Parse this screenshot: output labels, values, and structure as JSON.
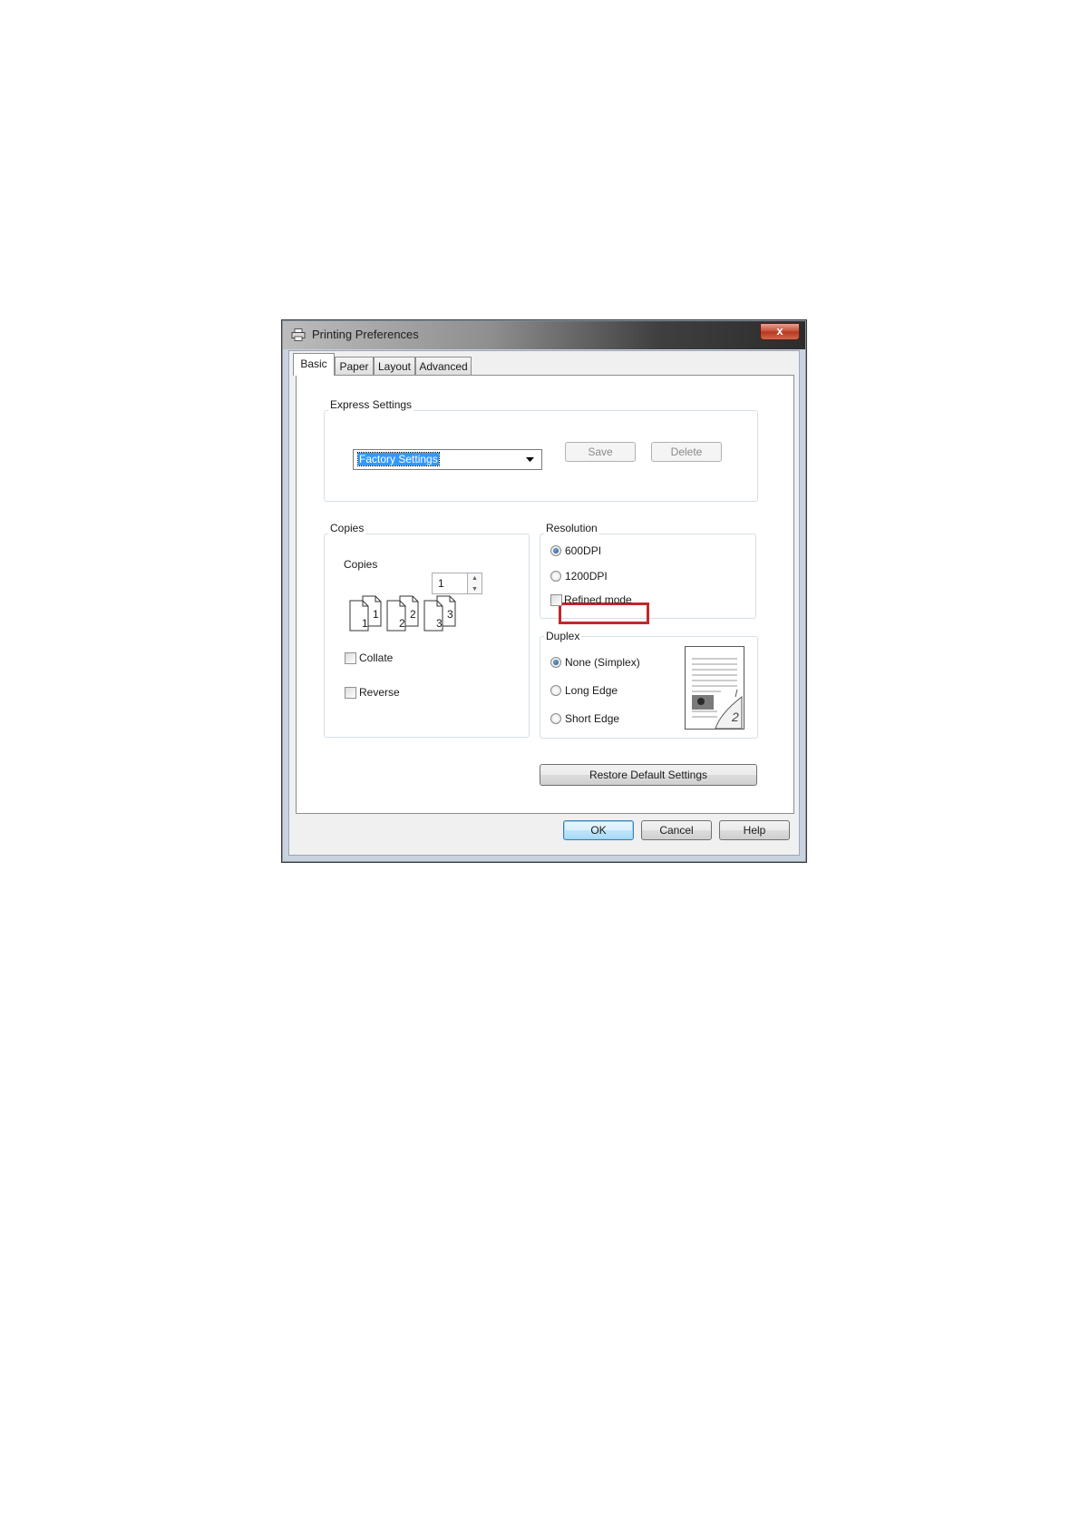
{
  "window": {
    "title": "Printing Preferences",
    "close_label": "x"
  },
  "tabs": [
    {
      "label": "Basic",
      "active": true
    },
    {
      "label": "Paper",
      "active": false
    },
    {
      "label": "Layout",
      "active": false
    },
    {
      "label": "Advanced",
      "active": false
    }
  ],
  "express_settings": {
    "legend": "Express Settings",
    "selected": "Factory Settings",
    "save_label": "Save",
    "delete_label": "Delete"
  },
  "copies_group": {
    "legend": "Copies",
    "copies_label": "Copies",
    "copies_value": "1",
    "page_icons": [
      {
        "front": "1",
        "back": "1"
      },
      {
        "front": "2",
        "back": "2"
      },
      {
        "front": "3",
        "back": "3"
      }
    ],
    "collate_label": "Collate",
    "collate_checked": false,
    "reverse_label": "Reverse",
    "reverse_checked": false
  },
  "resolution": {
    "legend": "Resolution",
    "options": [
      {
        "label": "600DPI",
        "checked": true
      },
      {
        "label": "1200DPI",
        "checked": false
      }
    ],
    "refined_label": "Refined mode",
    "refined_checked": false
  },
  "duplex": {
    "legend": "Duplex",
    "options": [
      {
        "label": "None (Simplex)",
        "checked": true
      },
      {
        "label": "Long Edge",
        "checked": false
      },
      {
        "label": "Short Edge",
        "checked": false
      }
    ],
    "preview_page_number": "2"
  },
  "restore_label": "Restore Default Settings",
  "footer": {
    "ok_label": "OK",
    "cancel_label": "Cancel",
    "help_label": "Help"
  },
  "colors": {
    "highlight_box": "#c0282d",
    "selection": "#3399ff",
    "close_button": "#c44a32"
  }
}
